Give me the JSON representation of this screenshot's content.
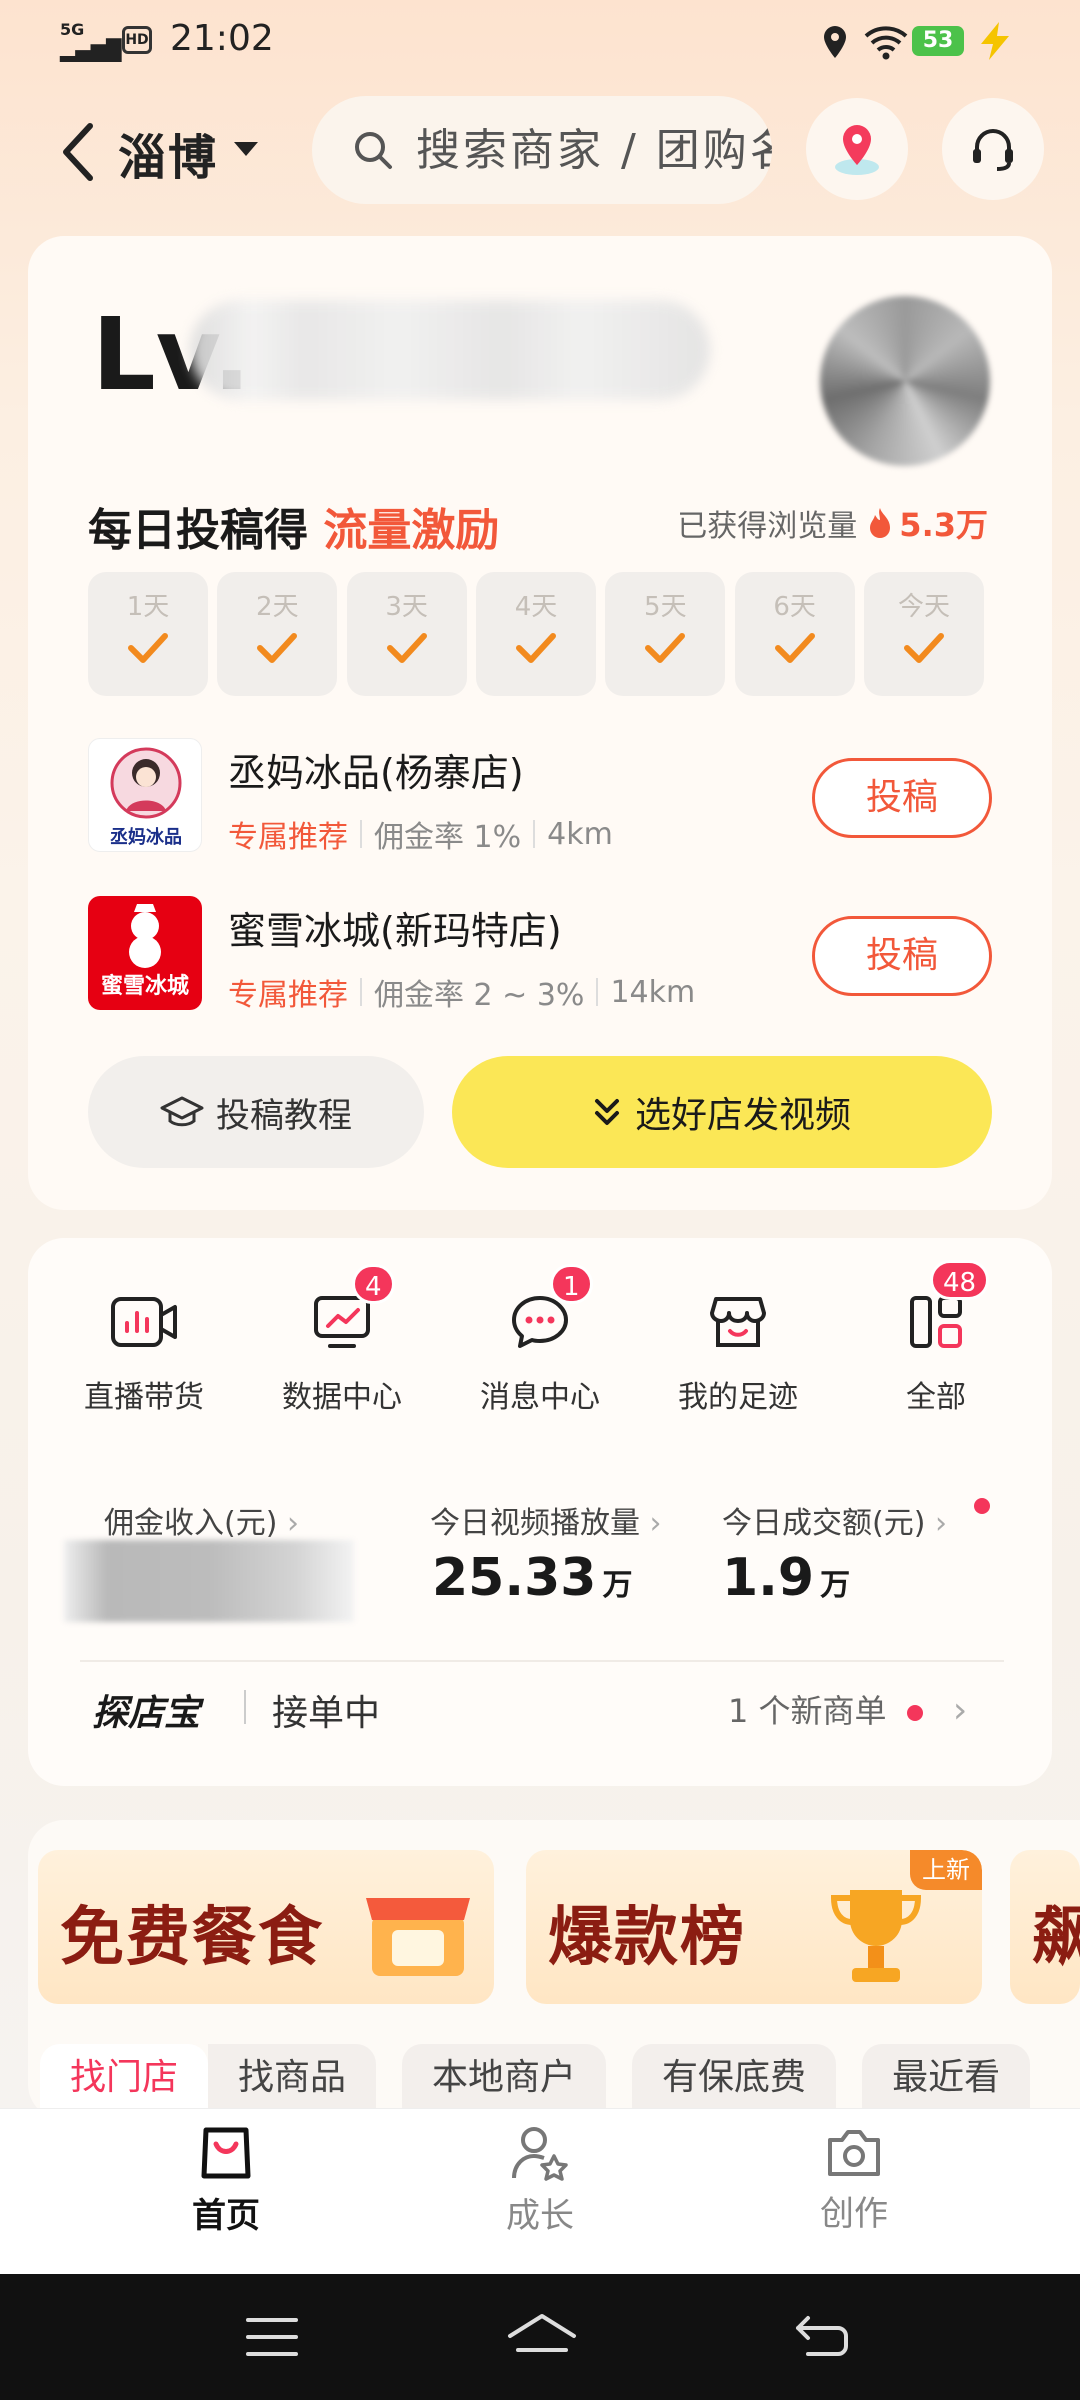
{
  "status_bar": {
    "network": "5G",
    "hd": "HD",
    "time": "21:02",
    "battery": "53"
  },
  "header": {
    "city": "淄博",
    "search_placeholder": "搜索商家 / 团购名"
  },
  "profile": {
    "level_prefix": "Lv."
  },
  "daily_task": {
    "title": "每日投稿得 ",
    "highlight": "流量激励",
    "views_label": "已获得浏览量",
    "views_value": "5.3万",
    "days": [
      {
        "label": "1天",
        "checked": true
      },
      {
        "label": "2天",
        "checked": true
      },
      {
        "label": "3天",
        "checked": true
      },
      {
        "label": "4天",
        "checked": true
      },
      {
        "label": "5天",
        "checked": true
      },
      {
        "label": "6天",
        "checked": true
      },
      {
        "label": "今天",
        "checked": true
      }
    ]
  },
  "shops": [
    {
      "name": "丞妈冰品(杨寨店)",
      "tag": "专属推荐",
      "commission": "佣金率 1%",
      "distance": "4km",
      "button": "投稿",
      "logo_text": "丞妈冰品"
    },
    {
      "name": "蜜雪冰城(新玛特店)",
      "tag": "专属推荐",
      "commission": "佣金率 2 ~ 3%",
      "distance": "14km",
      "button": "投稿",
      "logo_text": "蜜雪冰城"
    }
  ],
  "actions": {
    "tutorial": "投稿教程",
    "pick_shop": "选好店发视频"
  },
  "tools": [
    {
      "label": "直播带货",
      "icon": "live-icon",
      "badge": null
    },
    {
      "label": "数据中心",
      "icon": "data-chart-icon",
      "badge": "4"
    },
    {
      "label": "消息中心",
      "icon": "message-icon",
      "badge": "1"
    },
    {
      "label": "我的足迹",
      "icon": "shop-history-icon",
      "badge": null
    },
    {
      "label": "全部",
      "icon": "grid-icon",
      "badge": "48"
    }
  ],
  "stats": {
    "income_label": "佣金收入(元)",
    "plays_label": "今日视频播放量",
    "plays_value": "25.33",
    "plays_unit": "万",
    "gmv_label": "今日成交额(元)",
    "gmv_value": "1.9",
    "gmv_unit": "万"
  },
  "tandianbao": {
    "logo": "探店宝",
    "status": "接单中",
    "new_orders": "1 个新商单"
  },
  "promos": [
    {
      "title": "免费餐食"
    },
    {
      "title": "爆款榜",
      "tag": "上新"
    },
    {
      "title": "飙"
    }
  ],
  "chips": [
    "找门店",
    "找商品",
    "本地商户",
    "有保底费",
    "最近看"
  ],
  "tabbar": [
    {
      "label": "首页",
      "icon": "shopping-bag-icon",
      "active": true
    },
    {
      "label": "成长",
      "icon": "user-star-icon",
      "active": false
    },
    {
      "label": "创作",
      "icon": "camera-icon",
      "active": false
    }
  ],
  "colors": {
    "accent": "#f2583a",
    "badge": "#f4365b",
    "yellow_button": "#fbe756"
  }
}
